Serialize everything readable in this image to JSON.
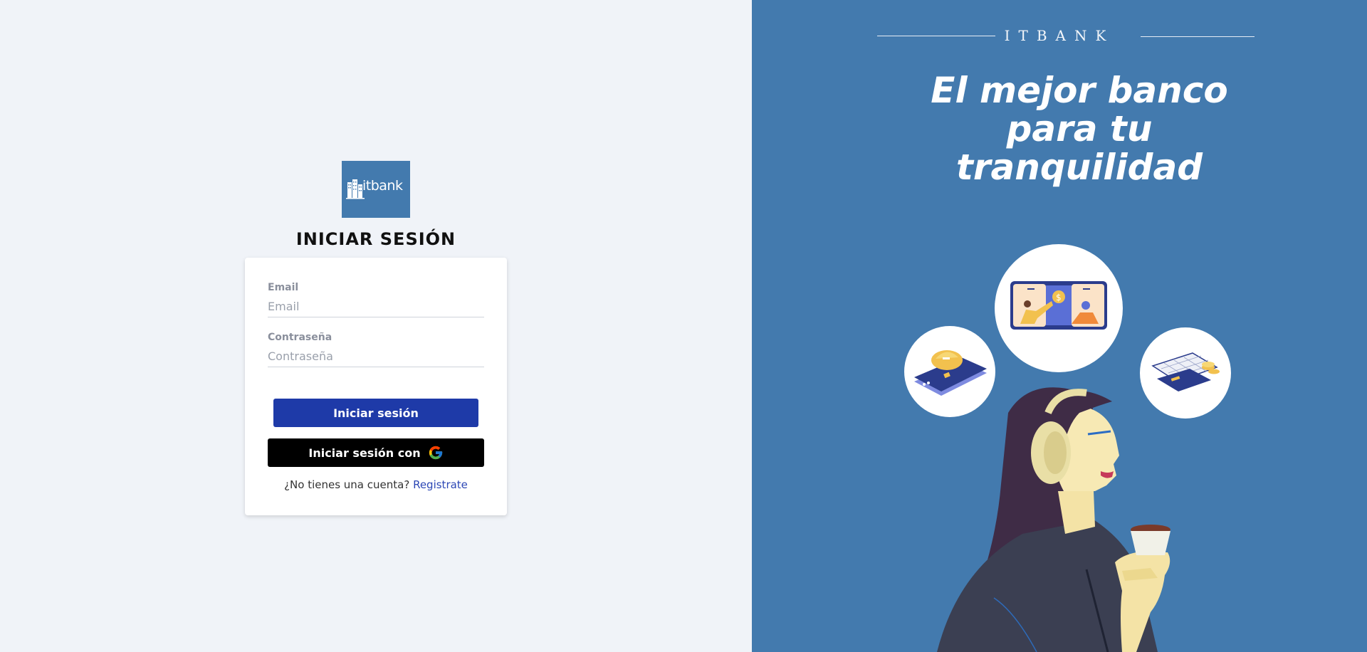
{
  "login": {
    "logo_text": "itbank",
    "title": "INICIAR SESIÓN",
    "email_label": "Email",
    "email_placeholder": "Email",
    "email_value": "",
    "password_label": "Contraseña",
    "password_placeholder": "Contraseña",
    "password_value": "",
    "submit_label": "Iniciar sesión",
    "google_label": "Iniciar sesión con",
    "signup_prompt": "¿No tienes una cuenta?",
    "signup_link": "Registrate"
  },
  "hero": {
    "brand": "ITBANK",
    "slogan_line1": "El mejor banco",
    "slogan_line2": "para tu",
    "slogan_line3": "tranquilidad"
  },
  "colors": {
    "page_bg": "#f0f3f8",
    "panel_blue": "#437aae",
    "primary_button": "#1e3aa8",
    "google_button": "#000000",
    "link": "#2c47b5"
  },
  "icons": [
    "building-icon",
    "google-icon",
    "mobile-banking-illustration",
    "card-security-illustration",
    "calendar-coins-illustration",
    "woman-with-headphones-illustration"
  ]
}
